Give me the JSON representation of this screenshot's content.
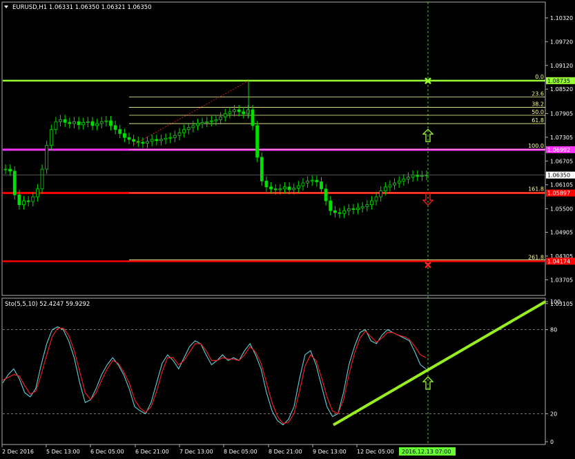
{
  "header": {
    "symbol": "EURUSD,H1",
    "open": "1.06331",
    "high": "1.06350",
    "low": "1.06321",
    "close": "1.06350"
  },
  "indicator": {
    "name": "Sto(5,5,10)",
    "main_value": "52.4247",
    "signal_value": "59.9292"
  },
  "colors": {
    "background": "#000000",
    "candles": "#00e000",
    "fib_levels": "#ffff99",
    "level_0": "#99ff33",
    "level_100": "#ff33ff",
    "level_161": "#ff0000",
    "level_261": "#ff0000",
    "stoch_main": "#5fd3e0",
    "stoch_signal": "#ff2020",
    "trendline": "#99ee22",
    "time_highlight": "#66ff33"
  },
  "chart_data": [
    {
      "type": "candlestick",
      "title": "EURUSD,H1",
      "ylim": [
        1.0331,
        1.1072
      ],
      "y_ticks": [
        "1.10320",
        "1.09720",
        "1.09120",
        "1.08520",
        "1.07905",
        "1.07305",
        "1.06705",
        "1.06105",
        "1.05500",
        "1.04905",
        "1.04305",
        "1.03705",
        "1.03105"
      ],
      "x_ticks": [
        "2 Dec 2016",
        "5 Dec 13:00",
        "6 Dec 05:00",
        "6 Dec 21:00",
        "7 Dec 13:00",
        "8 Dec 05:00",
        "8 Dec 21:00",
        "9 Dec 13:00",
        "12 Dec 05:00"
      ],
      "highlighted_time": "2016.12.13 07:00",
      "current_price": "1.06350",
      "horizontal_levels": [
        {
          "ratio": "0.0",
          "price": "1.08735"
        },
        {
          "ratio": "100.0",
          "price": "1.06992"
        },
        {
          "ratio": "161.8",
          "price": "1.05897"
        },
        {
          "ratio": "261.8",
          "price": "1.04174"
        }
      ],
      "fibonacci_levels": [
        "23.6",
        "38.2",
        "50.0",
        "61.8"
      ],
      "signals": [
        {
          "type": "stop-cross",
          "price": 1.0873
        },
        {
          "type": "up-arrow",
          "price": 1.0735
        },
        {
          "type": "down-arrow",
          "price": 1.0575
        },
        {
          "type": "stop-cross",
          "price": 1.0408
        }
      ],
      "close_series": [
        1.065,
        1.0645,
        1.0585,
        1.056,
        1.057,
        1.0568,
        1.058,
        1.06,
        1.065,
        1.071,
        1.075,
        1.077,
        1.0775,
        1.0768,
        1.0765,
        1.077,
        1.0762,
        1.0768,
        1.077,
        1.076,
        1.0765,
        1.077,
        1.0772,
        1.076,
        1.075,
        1.074,
        1.073,
        1.0725,
        1.072,
        1.0718,
        1.0715,
        1.072,
        1.0725,
        1.0722,
        1.0725,
        1.0728,
        1.073,
        1.0735,
        1.0742,
        1.075,
        1.0755,
        1.076,
        1.0765,
        1.0768,
        1.077,
        1.0772,
        1.0775,
        1.0782,
        1.079,
        1.0795,
        1.08,
        1.0795,
        1.079,
        1.08,
        1.076,
        1.068,
        1.062,
        1.0605,
        1.06,
        1.0598,
        1.06,
        1.0605,
        1.0598,
        1.0602,
        1.0608,
        1.0615,
        1.062,
        1.0622,
        1.0618,
        1.06,
        1.057,
        1.0545,
        1.054,
        1.0538,
        1.0545,
        1.055,
        1.0548,
        1.0552,
        1.0555,
        1.056,
        1.057,
        1.058,
        1.0595,
        1.0605,
        1.061,
        1.0615,
        1.062,
        1.0625,
        1.063,
        1.0635,
        1.0632,
        1.0634,
        1.0635
      ]
    },
    {
      "type": "line",
      "title": "Sto(5,5,10)",
      "ylim": [
        0,
        100
      ],
      "y_ticks": [
        "100",
        "80",
        "20",
        "0"
      ],
      "levels": [
        80,
        20
      ],
      "series": [
        {
          "name": "main",
          "values": [
            42,
            48,
            52,
            45,
            35,
            32,
            38,
            55,
            70,
            80,
            82,
            80,
            72,
            60,
            42,
            28,
            30,
            38,
            48,
            55,
            60,
            55,
            48,
            38,
            25,
            22,
            20,
            28,
            42,
            56,
            62,
            58,
            52,
            60,
            68,
            72,
            70,
            62,
            55,
            58,
            62,
            58,
            60,
            58,
            65,
            70,
            62,
            52,
            35,
            22,
            15,
            12,
            16,
            25,
            45,
            62,
            65,
            55,
            40,
            25,
            18,
            20,
            35,
            55,
            68,
            78,
            80,
            72,
            70,
            76,
            80,
            78,
            76,
            74,
            72,
            64,
            55,
            52
          ]
        },
        {
          "name": "signal",
          "values": [
            44,
            46,
            48,
            47,
            40,
            34,
            36,
            48,
            62,
            75,
            81,
            81,
            76,
            65,
            50,
            35,
            30,
            35,
            44,
            52,
            58,
            56,
            50,
            42,
            30,
            24,
            21,
            25,
            36,
            50,
            60,
            60,
            55,
            58,
            64,
            70,
            70,
            65,
            58,
            58,
            60,
            59,
            59,
            58,
            62,
            68,
            64,
            56,
            42,
            28,
            18,
            13,
            14,
            20,
            36,
            54,
            62,
            58,
            46,
            32,
            22,
            20,
            30,
            48,
            63,
            74,
            79,
            75,
            71,
            74,
            78,
            78,
            76,
            75,
            73,
            68,
            62,
            60
          ]
        }
      ],
      "trendline": [
        {
          "x": 0.615,
          "y": 12
        },
        {
          "x": 1.0,
          "y": 100
        }
      ]
    }
  ]
}
